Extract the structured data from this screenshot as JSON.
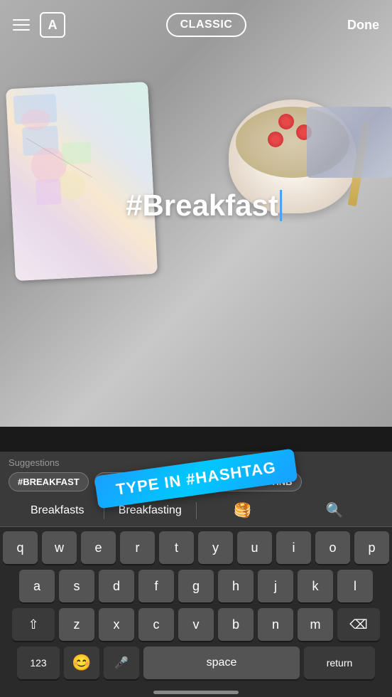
{
  "topbar": {
    "classic_label": "CLASSIC",
    "done_label": "Done",
    "text_style": "A"
  },
  "photo": {
    "hashtag_text": "#Breakfast"
  },
  "badge": {
    "label": "TYPE IN #HASHTAG"
  },
  "suggestions": {
    "label": "Suggestions",
    "chips": [
      "#BREAKFAST",
      "#BREAKFASTCLUB",
      "#BREAKFASTINB"
    ],
    "words": [
      "Breakfasts",
      "Breakfasting"
    ],
    "emojis": [
      "🥞",
      "🔍"
    ]
  },
  "keyboard": {
    "rows": [
      [
        "q",
        "w",
        "e",
        "r",
        "t",
        "y",
        "u",
        "i",
        "o",
        "p"
      ],
      [
        "a",
        "s",
        "d",
        "f",
        "g",
        "h",
        "j",
        "k",
        "l"
      ],
      [
        "z",
        "x",
        "c",
        "v",
        "b",
        "n",
        "m"
      ],
      [
        "123",
        "😊",
        "🎤",
        "space",
        "return"
      ]
    ],
    "shift_symbol": "⇧",
    "backspace_symbol": "⌫",
    "space_label": "space",
    "return_label": "return",
    "num_label": "123"
  }
}
